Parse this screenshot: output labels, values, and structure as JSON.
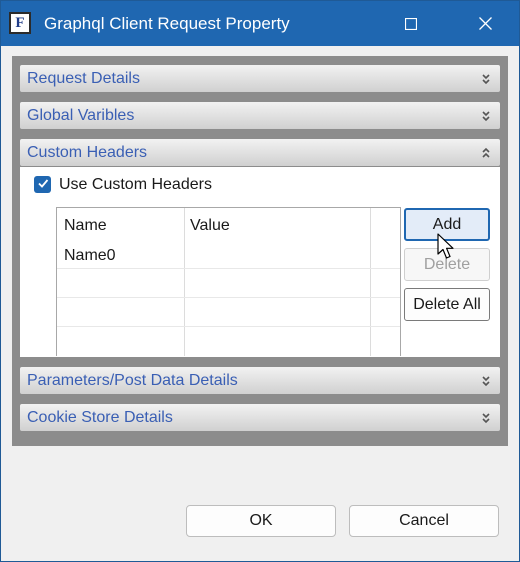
{
  "window": {
    "title": "Graphql Client Request Property",
    "app_icon_letter": "F"
  },
  "sections": {
    "request_details": "Request Details",
    "global_variables": "Global Varibles",
    "custom_headers": "Custom Headers",
    "parameters": "Parameters/Post Data Details",
    "cookie_store": "Cookie Store Details"
  },
  "custom_headers": {
    "use_custom_headers_label": "Use Custom Headers",
    "use_custom_headers_checked": true,
    "columns": [
      "Name",
      "Value"
    ],
    "rows": [
      {
        "name": "Name0",
        "value": ""
      }
    ],
    "buttons": {
      "add": "Add",
      "delete": "Delete",
      "delete_all": "Delete All"
    }
  },
  "footer": {
    "ok": "OK",
    "cancel": "Cancel"
  },
  "colors": {
    "titlebar": "#1f67b1",
    "section_text": "#3a5fb4",
    "checkbox": "#1f67b1"
  }
}
